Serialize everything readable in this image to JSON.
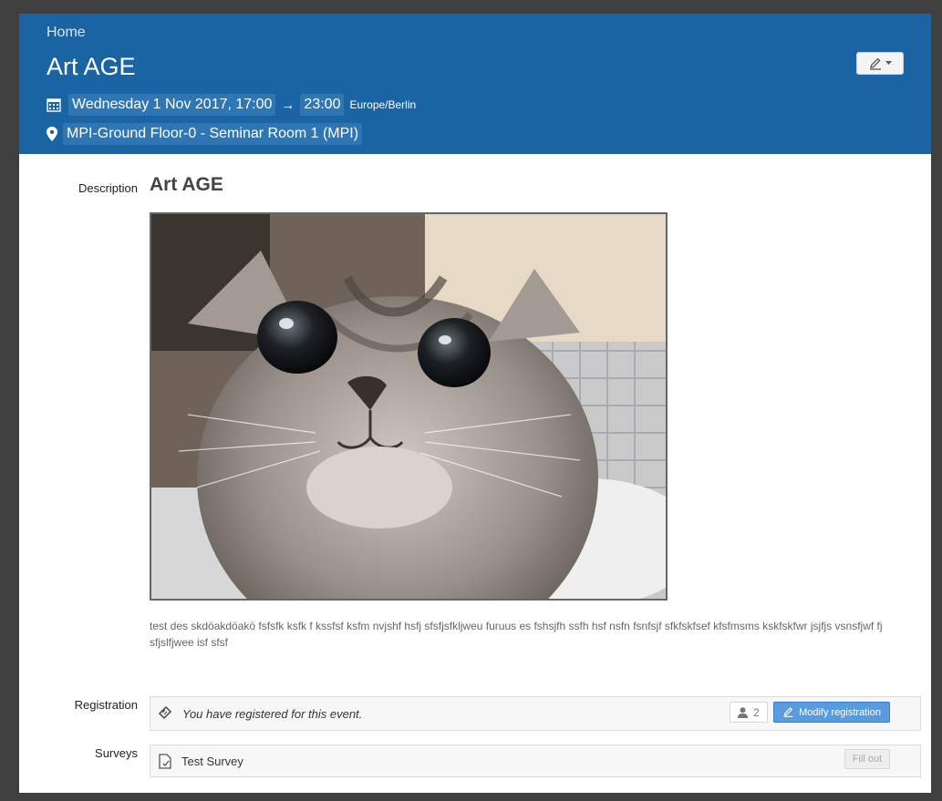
{
  "header": {
    "breadcrumb": "Home",
    "title": "Art AGE",
    "date_start": "Wednesday 1 Nov 2017, 17:00",
    "arrow": "→",
    "date_end": "23:00",
    "timezone": "Europe/Berlin",
    "location": "MPI-Ground Floor-0 - Seminar Room 1 (MPI)",
    "edit_icon": "pencil-icon",
    "dropdown_icon": "caret-down-icon"
  },
  "description": {
    "label": "Description",
    "heading": "Art AGE",
    "image_subject": "kitten photo",
    "text": "test des skdöakdöakö fsfsfk ksfk f kssfsf ksfm nvjshf hsfj sfsfjsfkljweu furuus es fshsjfh ssfh hsf nsfn fsnfsjf sfkfskfsef kfsfmsms kskfskfwr jsjfjs vsnsfjwf fj sfjslfjwee isf sfsf"
  },
  "registration": {
    "label": "Registration",
    "message": "You have registered for this event.",
    "count": "2",
    "modify_label": "Modify registration"
  },
  "surveys": {
    "label": "Surveys",
    "survey_name": "Test Survey",
    "fill_label": "Fill out"
  },
  "colors": {
    "header_bg": "#1a64a4",
    "highlight": "#2f76b4",
    "primary_button": "#5a9bdf",
    "page_bg": "#3f3f3f"
  }
}
